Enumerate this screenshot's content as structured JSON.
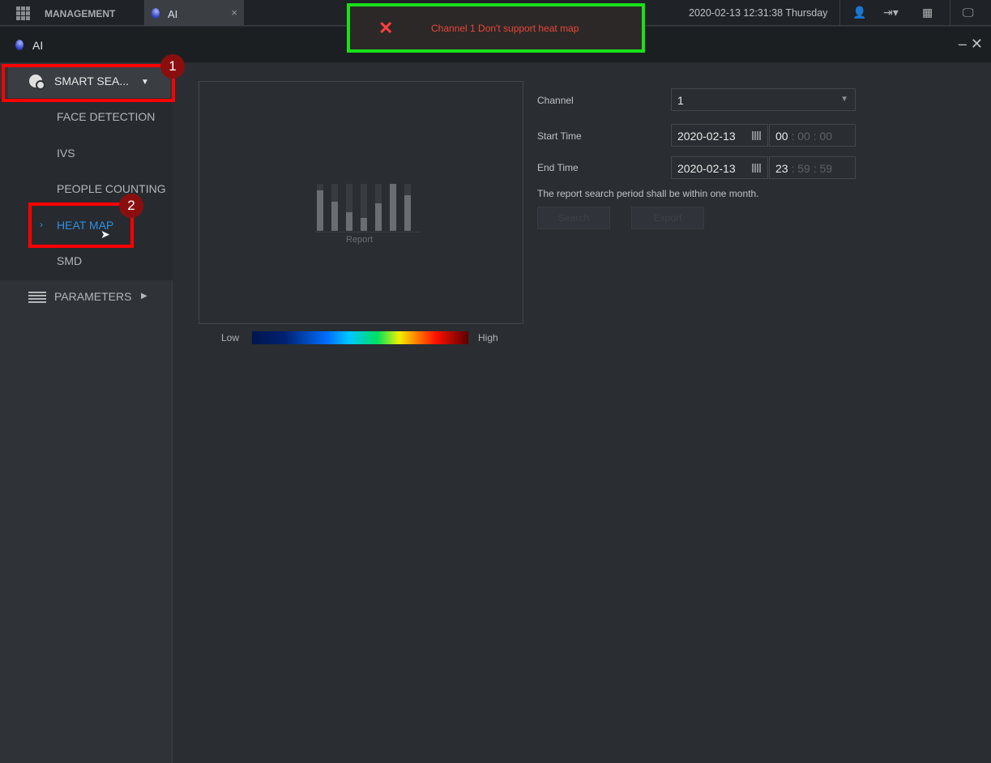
{
  "topbar": {
    "management": "MANAGEMENT",
    "tab_label": "AI",
    "tab_close": "×",
    "datetime": "2020-02-13 12:31:38 Thursday"
  },
  "window": {
    "title": "AI",
    "minimize": "–",
    "close": "✕"
  },
  "sidebar": {
    "smart_search": "SMART SEA...",
    "items": [
      "FACE DETECTION",
      "IVS",
      "PEOPLE COUNTING",
      "HEAT MAP",
      "SMD"
    ],
    "active": "HEAT MAP",
    "parameters": "PARAMETERS"
  },
  "annotations": {
    "badge1": "1",
    "badge2": "2"
  },
  "preview": {
    "placeholder_label": "Report",
    "legend_low": "Low",
    "legend_high": "High"
  },
  "form": {
    "channel_label": "Channel",
    "channel_value": "1",
    "start_label": "Start Time",
    "start_date": "2020-02-13",
    "start_h": "00",
    "start_m": "00",
    "start_s": "00",
    "end_label": "End Time",
    "end_date": "2020-02-13",
    "end_h": "23",
    "end_m": "59",
    "end_s": "59",
    "note": "The report search period shall be within one month.",
    "search": "Search",
    "export": "Export"
  },
  "toast": {
    "message": "Channel 1 Don't support heat map",
    "color": "#e9463a"
  }
}
